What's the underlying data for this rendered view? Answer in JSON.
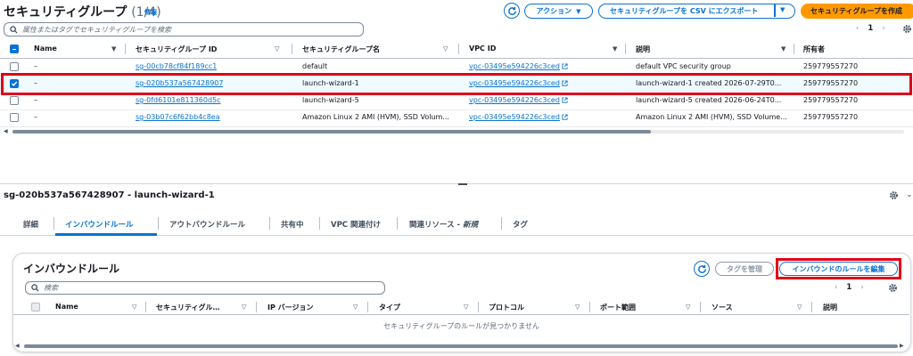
{
  "header": {
    "title": "セキュリティグループ",
    "count": "(1/4)",
    "info": "情報",
    "actions_label": "アクション",
    "export_label": "セキュリティグループを CSV にエクスポート",
    "create_label": "セキュリティグループを作成",
    "search_placeholder": "属性またはタグでセキュリティグループを検索",
    "page_number": "1"
  },
  "table": {
    "columns": [
      "Name",
      "セキュリティグループ ID",
      "セキュリティグループ名",
      "VPC ID",
      "説明",
      "所有者"
    ],
    "rows": [
      {
        "name": "–",
        "sg_id": "sg-00cb78cf84f189cc1",
        "sg_name": "default",
        "vpc_id": "vpc-03495e594226c3ced",
        "desc": "default VPC security group",
        "owner": "259779557270",
        "selected": false
      },
      {
        "name": "–",
        "sg_id": "sg-020b537a567428907",
        "sg_name": "launch-wizard-1",
        "vpc_id": "vpc-03495e594226c3ced",
        "desc": "launch-wizard-1 created 2026-07-29T0...",
        "owner": "259779557270",
        "selected": true
      },
      {
        "name": "–",
        "sg_id": "sg-0fd6101e811360d5c",
        "sg_name": "launch-wizard-5",
        "vpc_id": "vpc-03495e594226c3ced",
        "desc": "launch-wizard-5 created 2026-06-24T0...",
        "owner": "259779557270",
        "selected": false
      },
      {
        "name": "–",
        "sg_id": "sg-03b07c6f62bb4c8ea",
        "sg_name": "Amazon Linux 2 AMI (HVM), SSD Volum...",
        "vpc_id": "vpc-03495e594226c3ced",
        "desc": "Amazon Linux 2 AMI (HVM), SSD Volume...",
        "owner": "259779557270",
        "selected": false
      }
    ]
  },
  "detail": {
    "title": "sg-020b537a567428907 - launch-wizard-1",
    "tabs": [
      "詳細",
      "インバウンドルール",
      "アウトバウンドルール",
      "共有中",
      "VPC 関連付け",
      "関連リソース - ",
      "新規",
      "タグ"
    ]
  },
  "inbound": {
    "title": "インバウンドルール",
    "manage_tags_label": "タグを管理",
    "edit_label": "インバウンドのルールを編集",
    "search_placeholder": "検索",
    "page_number": "1",
    "columns": [
      "Name",
      "セキュリティグル…",
      "IP バージョン",
      "タイプ",
      "プロトコル",
      "ポート範囲",
      "ソース",
      "説明"
    ],
    "empty_message": "セキュリティグループのルールが見つかりません"
  },
  "colors": {
    "accent": "#0972d3",
    "primary": "#ff9900",
    "highlight": "#e0001a"
  }
}
